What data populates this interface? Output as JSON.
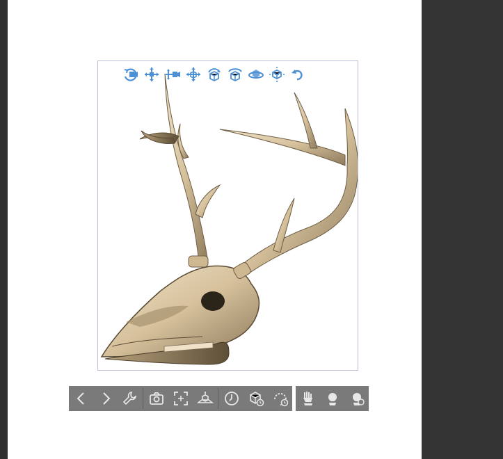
{
  "colors": {
    "canvas": "#ffffff",
    "panel": "#333333",
    "viewport_border": "#b9bdd6",
    "tool_icon": "#4b8fd6",
    "toolbar_bg": "#7a7a7a",
    "toolbar_icon": "#e8e8e8",
    "bone": "#d9c6a5"
  },
  "viewport": {
    "model": "deer-skull-with-antlers",
    "view_tools": [
      {
        "icon": "rotate-camera-icon"
      },
      {
        "icon": "pan-camera-icon"
      },
      {
        "icon": "dolly-camera-icon"
      },
      {
        "icon": "move-object-icon"
      },
      {
        "icon": "rotate-object-icon"
      },
      {
        "icon": "rotate-object-y-icon"
      },
      {
        "icon": "spin-object-icon"
      },
      {
        "icon": "move-on-plane-icon"
      },
      {
        "icon": "reset-rotation-icon"
      }
    ]
  },
  "bottom_toolbar": {
    "group1": [
      "previous-icon",
      "next-icon",
      "wrench-icon",
      "camera-icon",
      "fit-view-icon",
      "ground-icon",
      "clock-icon",
      "object-timer-icon",
      "rotate-timer-icon"
    ],
    "group2": [
      "pose-hand-icon",
      "pose-hand-2-icon",
      "pose-hand-3-icon"
    ]
  }
}
